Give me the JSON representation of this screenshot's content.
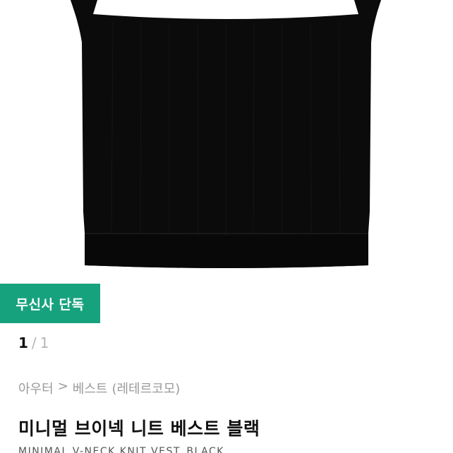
{
  "product": {
    "badge": "무신사 단독",
    "pager": {
      "current": "1",
      "separator": "/",
      "total": "1"
    },
    "breadcrumb": {
      "category": "아우터",
      "arrow": ">",
      "subcategory": "베스트",
      "brand": "(레테르코모)"
    },
    "title": "미니멀 브이넥 니트 베스트 블랙",
    "subtitle": "MINIMAL V-NECK KNIT VEST_BLACK"
  },
  "colors": {
    "badge_bg": "#17a27e",
    "garment": "#0b0b0b"
  }
}
